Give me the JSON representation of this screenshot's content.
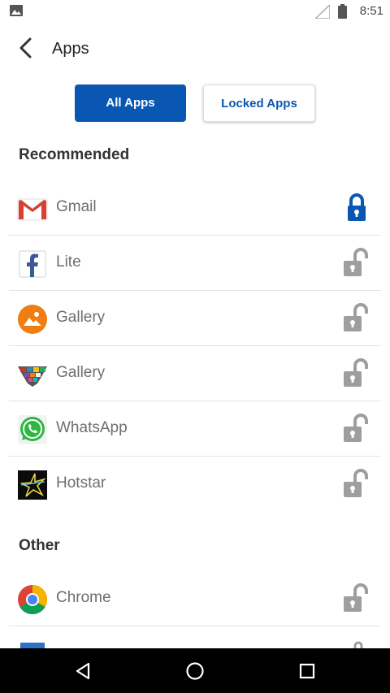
{
  "status_bar": {
    "time": "8:51",
    "icons": [
      "picture-icon",
      "signal-icon",
      "battery-icon"
    ]
  },
  "app_bar": {
    "title": "Apps",
    "back_icon": "back-arrow-icon"
  },
  "tabs": {
    "all_label": "All Apps",
    "locked_label": "Locked Apps",
    "active": "all"
  },
  "sections": {
    "recommended": "Recommended",
    "other": "Other"
  },
  "apps": {
    "recommended": [
      {
        "name": "Gmail",
        "icon": "gmail-icon",
        "locked": true
      },
      {
        "name": "Lite",
        "icon": "facebook-lite-icon",
        "locked": false
      },
      {
        "name": "Gallery",
        "icon": "gallery-icon",
        "locked": false
      },
      {
        "name": "Gallery",
        "icon": "gallery-collage-icon",
        "locked": false
      },
      {
        "name": "WhatsApp",
        "icon": "whatsapp-icon",
        "locked": false
      },
      {
        "name": "Hotstar",
        "icon": "hotstar-icon",
        "locked": false
      }
    ],
    "other": [
      {
        "name": "Chrome",
        "icon": "chrome-icon",
        "locked": false
      }
    ]
  },
  "colors": {
    "accent": "#0a57b3",
    "lock_locked": "#0a57b3",
    "lock_unlocked": "#9e9e9e",
    "text_muted": "#6e6e6e"
  },
  "nav_bar": {
    "icons": [
      "back-triangle-icon",
      "home-circle-icon",
      "recents-square-icon"
    ]
  }
}
